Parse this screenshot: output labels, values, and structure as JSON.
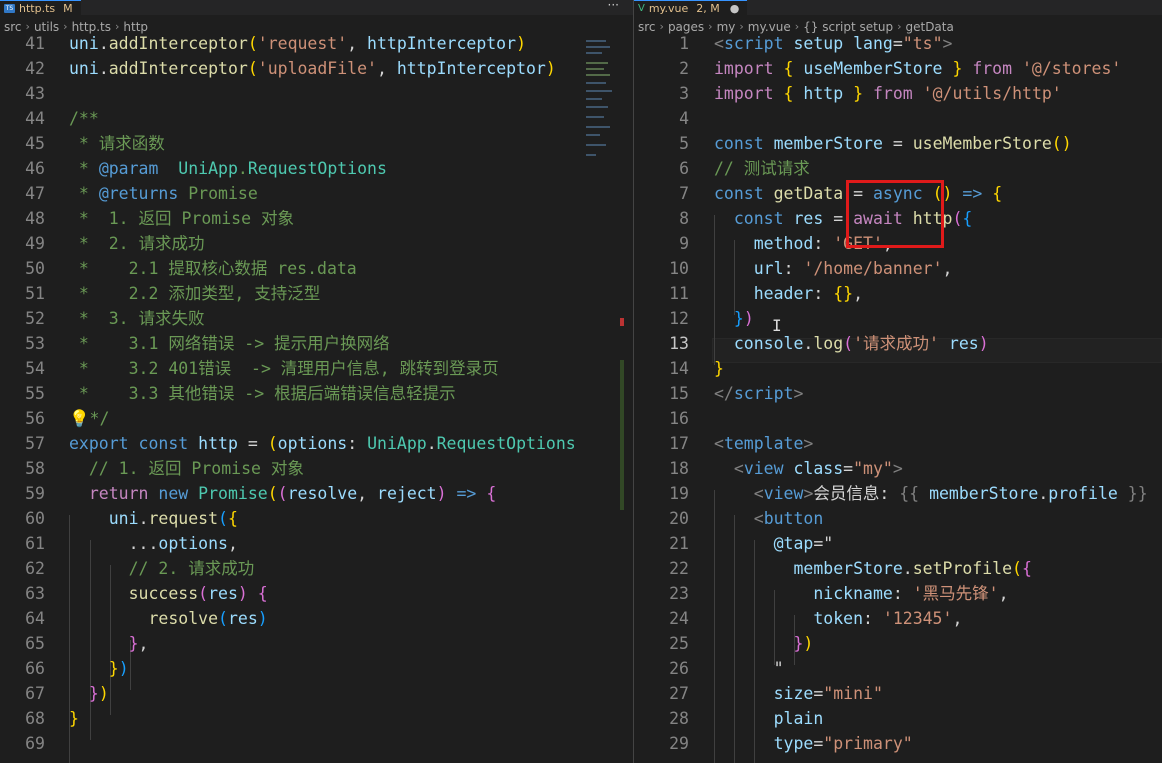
{
  "left": {
    "tab": {
      "name": "http.ts",
      "flag": "M"
    },
    "more_label": "···",
    "breadcrumb": [
      "src",
      "utils",
      "http.ts",
      "http"
    ],
    "lines": [
      {
        "n": "41",
        "segs": [
          [
            "var",
            "uni"
          ],
          [
            "",
            "."
          ],
          [
            "fn",
            "addInterceptor"
          ],
          [
            "brace",
            "("
          ],
          [
            "str",
            "'request'"
          ],
          [
            "",
            ", "
          ],
          [
            "var",
            "httpInterceptor"
          ],
          [
            "brace",
            ")"
          ]
        ]
      },
      {
        "n": "42",
        "segs": [
          [
            "var",
            "uni"
          ],
          [
            "",
            "."
          ],
          [
            "fn",
            "addInterceptor"
          ],
          [
            "brace",
            "("
          ],
          [
            "str",
            "'uploadFile'"
          ],
          [
            "",
            ", "
          ],
          [
            "var",
            "httpInterceptor"
          ],
          [
            "brace",
            ")"
          ]
        ]
      },
      {
        "n": "43",
        "segs": []
      },
      {
        "n": "44",
        "segs": [
          [
            "cm",
            "/**"
          ]
        ]
      },
      {
        "n": "45",
        "segs": [
          [
            "cm",
            " * 请求函数"
          ]
        ]
      },
      {
        "n": "46",
        "segs": [
          [
            "cm",
            " * "
          ],
          [
            "kw",
            "@param"
          ],
          [
            "cm",
            "  "
          ],
          [
            "type",
            "UniApp"
          ],
          [
            "cm",
            "."
          ],
          [
            "type",
            "RequestOptions"
          ]
        ]
      },
      {
        "n": "47",
        "segs": [
          [
            "cm",
            " * "
          ],
          [
            "kw",
            "@returns"
          ],
          [
            "cm",
            " Promise"
          ]
        ]
      },
      {
        "n": "48",
        "segs": [
          [
            "cm",
            " *  1. 返回 Promise 对象"
          ]
        ]
      },
      {
        "n": "49",
        "segs": [
          [
            "cm",
            " *  2. 请求成功"
          ]
        ]
      },
      {
        "n": "50",
        "segs": [
          [
            "cm",
            " *    2.1 提取核心数据 res.data"
          ]
        ]
      },
      {
        "n": "51",
        "segs": [
          [
            "cm",
            " *    2.2 添加类型, 支持泛型"
          ]
        ]
      },
      {
        "n": "52",
        "segs": [
          [
            "cm",
            " *  3. 请求失败"
          ]
        ]
      },
      {
        "n": "53",
        "segs": [
          [
            "cm",
            " *    3.1 网络错误 -> 提示用户换网络"
          ]
        ]
      },
      {
        "n": "54",
        "segs": [
          [
            "cm",
            " *    3.2 401错误  -> 清理用户信息, 跳转到登录页"
          ]
        ]
      },
      {
        "n": "55",
        "segs": [
          [
            "cm",
            " *    3.3 其他错误 -> 根据后端错误信息轻提示"
          ]
        ]
      },
      {
        "n": "56",
        "segs": [
          [
            "bulb",
            "💡"
          ],
          [
            "cm",
            "*/"
          ]
        ]
      },
      {
        "n": "57",
        "segs": [
          [
            "kw",
            "export"
          ],
          [
            "",
            " "
          ],
          [
            "kw",
            "const"
          ],
          [
            "",
            " "
          ],
          [
            "var",
            "http"
          ],
          [
            "",
            " = "
          ],
          [
            "brace",
            "("
          ],
          [
            "var",
            "options"
          ],
          [
            "",
            ": "
          ],
          [
            "type",
            "UniApp"
          ],
          [
            "",
            "."
          ],
          [
            "type",
            "RequestOptions"
          ]
        ]
      },
      {
        "n": "58",
        "segs": [
          [
            "",
            "  "
          ],
          [
            "cm",
            "// 1. 返回 Promise 对象"
          ]
        ]
      },
      {
        "n": "59",
        "segs": [
          [
            "",
            "  "
          ],
          [
            "ctl",
            "return"
          ],
          [
            "",
            " "
          ],
          [
            "kw",
            "new"
          ],
          [
            "",
            " "
          ],
          [
            "type",
            "Promise"
          ],
          [
            "brace",
            "("
          ],
          [
            "brace2",
            "("
          ],
          [
            "var",
            "resolve"
          ],
          [
            "",
            ", "
          ],
          [
            "var",
            "reject"
          ],
          [
            "brace2",
            ")"
          ],
          [
            "",
            " "
          ],
          [
            "kw",
            "=>"
          ],
          [
            "",
            " "
          ],
          [
            "brace2",
            "{"
          ]
        ]
      },
      {
        "n": "60",
        "segs": [
          [
            "",
            "    "
          ],
          [
            "var",
            "uni"
          ],
          [
            "",
            "."
          ],
          [
            "fn",
            "request"
          ],
          [
            "brace3",
            "("
          ],
          [
            "brace",
            "{"
          ]
        ]
      },
      {
        "n": "61",
        "segs": [
          [
            "",
            "      ..."
          ],
          [
            "var",
            "options"
          ],
          [
            "",
            ","
          ]
        ]
      },
      {
        "n": "62",
        "segs": [
          [
            "",
            "      "
          ],
          [
            "cm",
            "// 2. 请求成功"
          ]
        ]
      },
      {
        "n": "63",
        "segs": [
          [
            "",
            "      "
          ],
          [
            "fn",
            "success"
          ],
          [
            "brace2",
            "("
          ],
          [
            "var",
            "res"
          ],
          [
            "brace2",
            ")"
          ],
          [
            "",
            " "
          ],
          [
            "brace2",
            "{"
          ]
        ]
      },
      {
        "n": "64",
        "segs": [
          [
            "",
            "        "
          ],
          [
            "fn",
            "resolve"
          ],
          [
            "brace3",
            "("
          ],
          [
            "var",
            "res"
          ],
          [
            "brace3",
            ")"
          ]
        ]
      },
      {
        "n": "65",
        "segs": [
          [
            "",
            "      "
          ],
          [
            "brace2",
            "}"
          ],
          [
            "",
            ","
          ]
        ]
      },
      {
        "n": "66",
        "segs": [
          [
            "",
            "    "
          ],
          [
            "brace",
            "}"
          ],
          [
            "brace3",
            ")"
          ]
        ]
      },
      {
        "n": "67",
        "segs": [
          [
            "",
            "  "
          ],
          [
            "brace2",
            "}"
          ],
          [
            "brace",
            ")"
          ]
        ]
      },
      {
        "n": "68",
        "segs": [
          [
            "brace",
            "}"
          ]
        ]
      },
      {
        "n": "69",
        "segs": []
      }
    ]
  },
  "right": {
    "tab": {
      "name": "my.vue",
      "flag": "2, M"
    },
    "breadcrumb": [
      "src",
      "pages",
      "my",
      "my.vue",
      "{} script setup",
      "getData"
    ],
    "active_line": "13",
    "lines": [
      {
        "n": "1",
        "segs": [
          [
            "punct",
            "<"
          ],
          [
            "tag",
            "script"
          ],
          [
            "",
            " "
          ],
          [
            "attr",
            "setup"
          ],
          [
            "",
            " "
          ],
          [
            "attr",
            "lang"
          ],
          [
            "",
            "="
          ],
          [
            "str",
            "\"ts\""
          ],
          [
            "punct",
            ">"
          ]
        ]
      },
      {
        "n": "2",
        "segs": [
          [
            "ctl",
            "import"
          ],
          [
            "",
            " "
          ],
          [
            "brace",
            "{"
          ],
          [
            "",
            " "
          ],
          [
            "var",
            "useMemberStore"
          ],
          [
            "",
            " "
          ],
          [
            "brace",
            "}"
          ],
          [
            "",
            " "
          ],
          [
            "ctl",
            "from"
          ],
          [
            "",
            " "
          ],
          [
            "str",
            "'@/stores'"
          ]
        ]
      },
      {
        "n": "3",
        "segs": [
          [
            "ctl",
            "import"
          ],
          [
            "",
            " "
          ],
          [
            "brace",
            "{"
          ],
          [
            "",
            " "
          ],
          [
            "var",
            "http"
          ],
          [
            "",
            " "
          ],
          [
            "brace",
            "}"
          ],
          [
            "",
            " "
          ],
          [
            "ctl",
            "from"
          ],
          [
            "",
            " "
          ],
          [
            "str",
            "'@/utils/http'"
          ]
        ]
      },
      {
        "n": "4",
        "segs": []
      },
      {
        "n": "5",
        "segs": [
          [
            "kw",
            "const"
          ],
          [
            "",
            " "
          ],
          [
            "var",
            "memberStore"
          ],
          [
            "",
            " = "
          ],
          [
            "fn",
            "useMemberStore"
          ],
          [
            "brace",
            "()"
          ]
        ]
      },
      {
        "n": "6",
        "segs": [
          [
            "cm",
            "// 测试请求"
          ]
        ]
      },
      {
        "n": "7",
        "segs": [
          [
            "kw",
            "const"
          ],
          [
            "",
            " "
          ],
          [
            "fn",
            "getData"
          ],
          [
            "",
            " = "
          ],
          [
            "kw",
            "async"
          ],
          [
            "",
            " "
          ],
          [
            "brace",
            "()"
          ],
          [
            "",
            " "
          ],
          [
            "kw",
            "=>"
          ],
          [
            "",
            " "
          ],
          [
            "brace",
            "{"
          ]
        ]
      },
      {
        "n": "8",
        "segs": [
          [
            "",
            "  "
          ],
          [
            "kw",
            "const"
          ],
          [
            "",
            " "
          ],
          [
            "var",
            "res"
          ],
          [
            "",
            " = "
          ],
          [
            "ctl",
            "await"
          ],
          [
            "",
            " "
          ],
          [
            "fn",
            "http"
          ],
          [
            "brace2",
            "("
          ],
          [
            "brace3",
            "{"
          ]
        ]
      },
      {
        "n": "9",
        "segs": [
          [
            "",
            "    "
          ],
          [
            "var",
            "method"
          ],
          [
            "",
            ": "
          ],
          [
            "str",
            "'GET'"
          ],
          [
            "",
            ","
          ]
        ]
      },
      {
        "n": "10",
        "segs": [
          [
            "",
            "    "
          ],
          [
            "var",
            "url"
          ],
          [
            "",
            ": "
          ],
          [
            "str",
            "'/home/banner'"
          ],
          [
            "",
            ","
          ]
        ]
      },
      {
        "n": "11",
        "segs": [
          [
            "",
            "    "
          ],
          [
            "var",
            "header"
          ],
          [
            "",
            ": "
          ],
          [
            "brace",
            "{}"
          ],
          [
            "",
            ","
          ]
        ]
      },
      {
        "n": "12",
        "segs": [
          [
            "",
            "  "
          ],
          [
            "brace3",
            "}"
          ],
          [
            "brace2",
            ")"
          ]
        ]
      },
      {
        "n": "13",
        "segs": [
          [
            "",
            "  "
          ],
          [
            "var",
            "console"
          ],
          [
            "",
            "."
          ],
          [
            "fn",
            "log"
          ],
          [
            "brace2",
            "("
          ],
          [
            "str",
            "'请求成功'"
          ],
          [
            "",
            " "
          ],
          [
            "var",
            "res"
          ],
          [
            "brace2",
            ")"
          ]
        ]
      },
      {
        "n": "14",
        "segs": [
          [
            "brace",
            "}"
          ]
        ]
      },
      {
        "n": "15",
        "segs": [
          [
            "punct",
            "</"
          ],
          [
            "tag",
            "script"
          ],
          [
            "punct",
            ">"
          ]
        ]
      },
      {
        "n": "16",
        "segs": []
      },
      {
        "n": "17",
        "segs": [
          [
            "punct",
            "<"
          ],
          [
            "tag",
            "template"
          ],
          [
            "punct",
            ">"
          ]
        ]
      },
      {
        "n": "18",
        "segs": [
          [
            "",
            "  "
          ],
          [
            "punct",
            "<"
          ],
          [
            "tag",
            "view"
          ],
          [
            "",
            " "
          ],
          [
            "attr",
            "class"
          ],
          [
            "",
            "="
          ],
          [
            "str",
            "\"my\""
          ],
          [
            "punct",
            ">"
          ]
        ]
      },
      {
        "n": "19",
        "segs": [
          [
            "",
            "    "
          ],
          [
            "punct",
            "<"
          ],
          [
            "tag",
            "view"
          ],
          [
            "punct",
            ">"
          ],
          [
            "",
            "会员信息: "
          ],
          [
            "punct",
            "{{"
          ],
          [
            "",
            " "
          ],
          [
            "var",
            "memberStore"
          ],
          [
            "",
            "."
          ],
          [
            "var",
            "profile"
          ],
          [
            "",
            " "
          ],
          [
            "punct",
            "}}"
          ]
        ]
      },
      {
        "n": "20",
        "segs": [
          [
            "",
            "    "
          ],
          [
            "punct",
            "<"
          ],
          [
            "tag",
            "button"
          ]
        ]
      },
      {
        "n": "21",
        "segs": [
          [
            "",
            "      "
          ],
          [
            "attr",
            "@tap"
          ],
          [
            "",
            "=\""
          ]
        ]
      },
      {
        "n": "22",
        "segs": [
          [
            "",
            "        "
          ],
          [
            "var",
            "memberStore"
          ],
          [
            "",
            "."
          ],
          [
            "fn",
            "setProfile"
          ],
          [
            "brace",
            "("
          ],
          [
            "brace2",
            "{"
          ]
        ]
      },
      {
        "n": "23",
        "segs": [
          [
            "",
            "          "
          ],
          [
            "var",
            "nickname"
          ],
          [
            "",
            ": "
          ],
          [
            "str",
            "'黑马先锋'"
          ],
          [
            "",
            ","
          ]
        ]
      },
      {
        "n": "24",
        "segs": [
          [
            "",
            "          "
          ],
          [
            "var",
            "token"
          ],
          [
            "",
            ": "
          ],
          [
            "str",
            "'12345'"
          ],
          [
            "",
            ","
          ]
        ]
      },
      {
        "n": "25",
        "segs": [
          [
            "",
            "        "
          ],
          [
            "brace2",
            "}"
          ],
          [
            "brace",
            ")"
          ]
        ]
      },
      {
        "n": "26",
        "segs": [
          [
            "",
            "      \""
          ]
        ]
      },
      {
        "n": "27",
        "segs": [
          [
            "",
            "      "
          ],
          [
            "attr",
            "size"
          ],
          [
            "",
            "="
          ],
          [
            "str",
            "\"mini\""
          ]
        ]
      },
      {
        "n": "28",
        "segs": [
          [
            "",
            "      "
          ],
          [
            "attr",
            "plain"
          ]
        ]
      },
      {
        "n": "29",
        "segs": [
          [
            "",
            "      "
          ],
          [
            "attr",
            "type"
          ],
          [
            "",
            "="
          ],
          [
            "str",
            "\"primary\""
          ]
        ]
      }
    ]
  },
  "colors": {
    "highlight_box": "#e01a1a",
    "tab_modified": "#e2c08d",
    "editor_bg": "#1e1e1e"
  }
}
